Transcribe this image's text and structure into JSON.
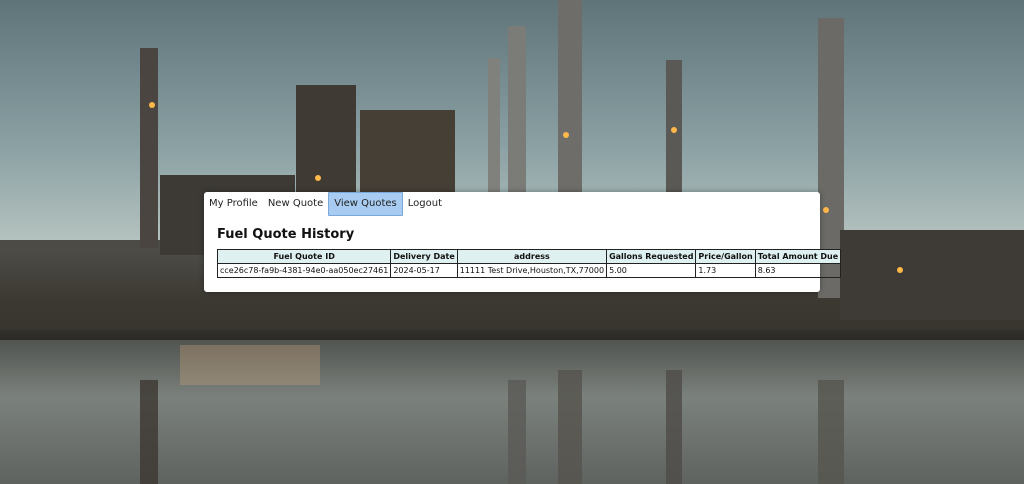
{
  "nav": {
    "items": [
      {
        "label": "My Profile",
        "active": false
      },
      {
        "label": "New Quote",
        "active": false
      },
      {
        "label": "View Quotes",
        "active": true
      },
      {
        "label": "Logout",
        "active": false
      }
    ]
  },
  "page": {
    "title": "Fuel Quote History"
  },
  "table": {
    "headers": [
      "Fuel Quote ID",
      "Delivery Date",
      "address",
      "Gallons Requested",
      "Price/Gallon",
      "Total Amount Due"
    ],
    "rows": [
      [
        "cce26c78-fa9b-4381-94e0-aa050ec27461",
        "2024-05-17",
        "11111 Test Drive,Houston,TX,77000",
        "5.00",
        "1.73",
        "8.63"
      ]
    ]
  },
  "colors": {
    "active_tab": "#a8ccf1",
    "table_header": "#dff0f0"
  },
  "background": {
    "icon": "refinery-photo"
  }
}
